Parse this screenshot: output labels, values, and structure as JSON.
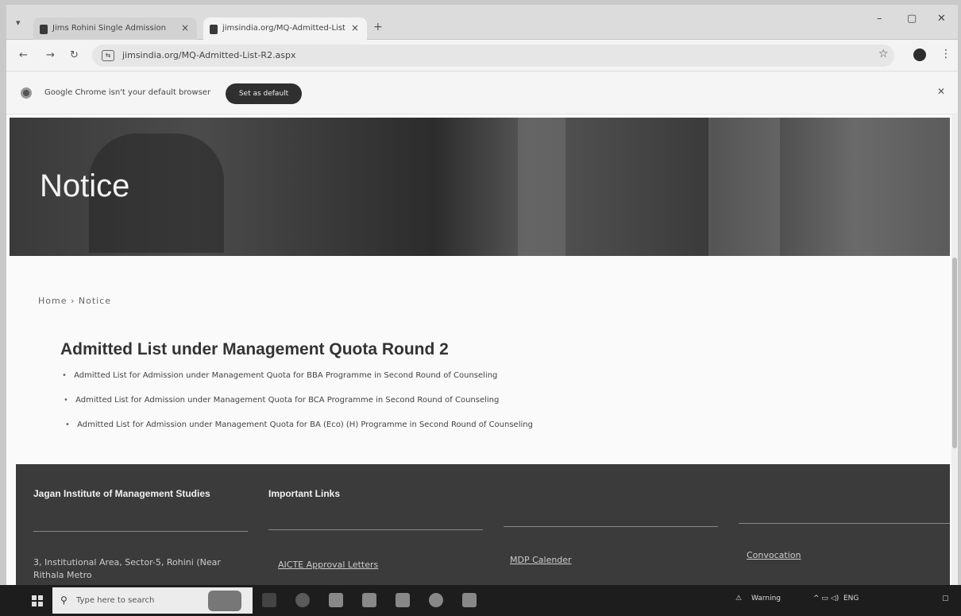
{
  "browser": {
    "tabs": [
      {
        "title": "Jims Rohini Single Admission"
      },
      {
        "title": "jimsindia.org/MQ-Admitted-List"
      }
    ],
    "address": "jimsindia.org/MQ-Admitted-List-R2.aspx",
    "infobar_text": "Google Chrome isn't your default browser",
    "infobar_button": "Set as default"
  },
  "page": {
    "hero_title": "Notice",
    "breadcrumb": "Home › Notice",
    "notice_title": "Admitted List under Management Quota Round 2",
    "notices": [
      "Admitted List for Admission under Management Quota for BBA Programme in Second Round of Counseling",
      "Admitted List for Admission under Management Quota for BCA Programme in Second Round of Counseling",
      "Admitted List for Admission under Management Quota for BA (Eco) (H) Programme in Second Round of Counseling"
    ]
  },
  "footer": {
    "org_name": "Jagan Institute of Management Studies",
    "links_heading": "Important Links",
    "address": "3, Institutional Area, Sector-5, Rohini (Near Rithala Metro",
    "link1": "AICTE Approval Letters",
    "link2": "MDP Calender",
    "link3": "Convocation"
  },
  "taskbar": {
    "search_placeholder": "Type here to search",
    "weather": "Warning",
    "lang": "ENG"
  }
}
